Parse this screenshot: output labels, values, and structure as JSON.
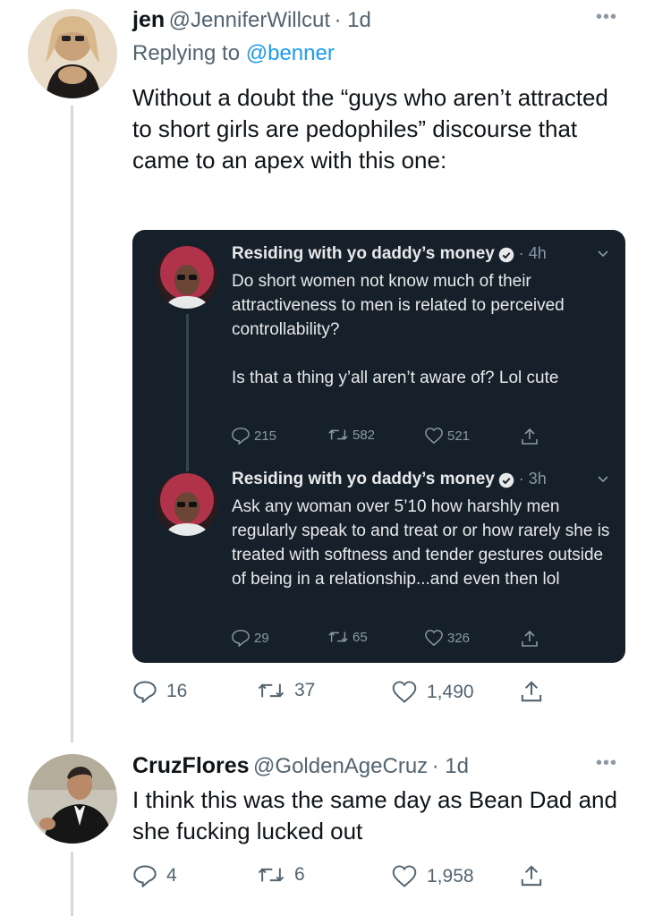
{
  "tweet1": {
    "name": "jen",
    "handle": "@JenniferWillcut",
    "time": "· 1d",
    "reply_prefix": "Replying to ",
    "reply_to": "@benner",
    "text": "Without a doubt the “guys who aren’t attracted to short girls are pedophiles” discourse that came to an apex with this one:",
    "replies": "16",
    "retweets": "37",
    "likes": "1,490"
  },
  "quote1": {
    "name": "Residing with yo daddy’s money",
    "time": "· 4h",
    "text1": "Do short women not know much of their attractiveness to men is related to perceived controllability?",
    "text2": "Is that a thing y’all aren’t aware of? Lol cute",
    "replies": "215",
    "retweets": "582",
    "likes": "521"
  },
  "quote2": {
    "name": "Residing with yo daddy’s money",
    "time": "· 3h",
    "text": "Ask any woman over 5’10 how harshly men regularly speak to and treat or or how rarely she is treated with softness and tender gestures outside of being in a relationship...and even then lol",
    "replies": "29",
    "retweets": "65",
    "likes": "326"
  },
  "tweet2": {
    "name": "CruzFlores",
    "handle": "@GoldenAgeCruz",
    "time": "· 1d",
    "text": "I think this was the same day as Bean Dad and she fucking lucked out",
    "replies": "4",
    "retweets": "6",
    "likes": "1,958"
  },
  "colors": {
    "link": "#1d9bf0",
    "card_bg": "#15202b",
    "muted": "#536471",
    "thread_line": "#cfd9de"
  }
}
